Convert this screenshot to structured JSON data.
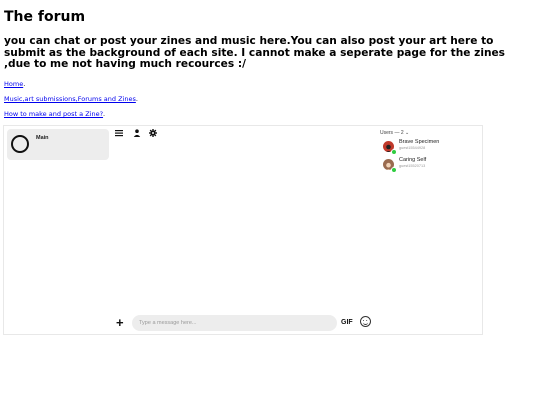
{
  "page": {
    "title": "The forum",
    "subtitle": "you can chat or post your zines and music here.You can also post your art here to submit as the background of each site. I cannot make a seperate page for the zines ,due to me not having much recources :/"
  },
  "links": [
    {
      "label": "Home",
      "suffix": "."
    },
    {
      "label": "Music,art submissions,Forums and Zines",
      "suffix": "."
    },
    {
      "label": "How to make and post a Zine?",
      "suffix": "."
    }
  ],
  "chat": {
    "channel": {
      "name": "Main"
    },
    "toolbar": {
      "menu_icon": "menu-icon",
      "user_icon": "user-icon",
      "settings_icon": "gear-icon"
    },
    "users_header": "Users — 2 ⌄",
    "users": [
      {
        "name": "Brave Specimen",
        "id": "guest15544928",
        "avatar_color": "#c0392b",
        "status_color": "#2ecc40"
      },
      {
        "name": "Caring Self",
        "id": "guest15520713",
        "avatar_color": "#9a6b4f",
        "status_color": "#2ecc40"
      }
    ],
    "composer": {
      "attach_symbol": "+",
      "placeholder": "Type a message here...",
      "gif_label": "GIF",
      "emoji_icon": "smiley-icon"
    }
  }
}
